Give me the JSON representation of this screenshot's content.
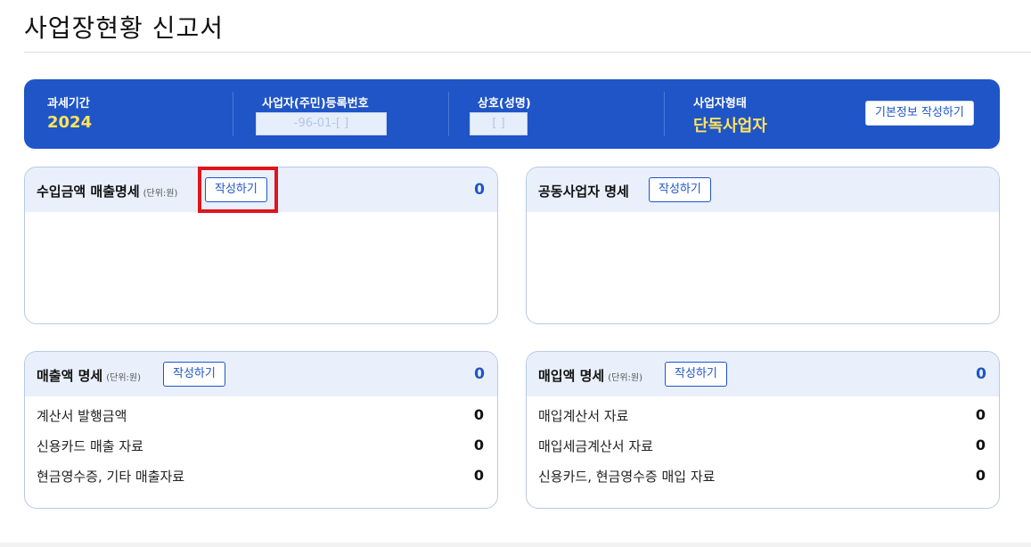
{
  "page": {
    "title": "사업장현황 신고서"
  },
  "info_bar": {
    "tax_period_label": "과세기간",
    "tax_period_value": "2024",
    "reg_no_label": "사업자(주민)등록번호",
    "reg_no_value": "-96-01-[  ]",
    "trade_name_label": "상호(성명)",
    "trade_name_value": "[  ]",
    "biz_type_label": "사업자형태",
    "biz_type_value": "단독사업자",
    "edit_basic_button": "기본정보 작성하기"
  },
  "cards": {
    "income": {
      "title": "수입금액 매출명세",
      "unit": "(단위:원)",
      "button": "작성하기",
      "total": "0"
    },
    "partners": {
      "title": "공동사업자 명세",
      "button": "작성하기"
    },
    "sales": {
      "title": "매출액 명세",
      "unit": "(단위:원)",
      "button": "작성하기",
      "total": "0",
      "rows": [
        {
          "label": "계산서 발행금액",
          "value": "0"
        },
        {
          "label": "신용카드 매출 자료",
          "value": "0"
        },
        {
          "label": "현금영수증, 기타 매출자료",
          "value": "0"
        }
      ]
    },
    "purchase": {
      "title": "매입액 명세",
      "unit": "(단위:원)",
      "button": "작성하기",
      "total": "0",
      "rows": [
        {
          "label": "매입계산서 자료",
          "value": "0"
        },
        {
          "label": "매입세금계산서 자료",
          "value": "0"
        },
        {
          "label": "신용카드, 현금영수증 매입 자료",
          "value": "0"
        }
      ]
    }
  },
  "colors": {
    "brand": "#1f55c7",
    "highlight_value": "#ffe45c",
    "header_bg": "#e9f0fc",
    "annotation_red": "#e0141c"
  }
}
